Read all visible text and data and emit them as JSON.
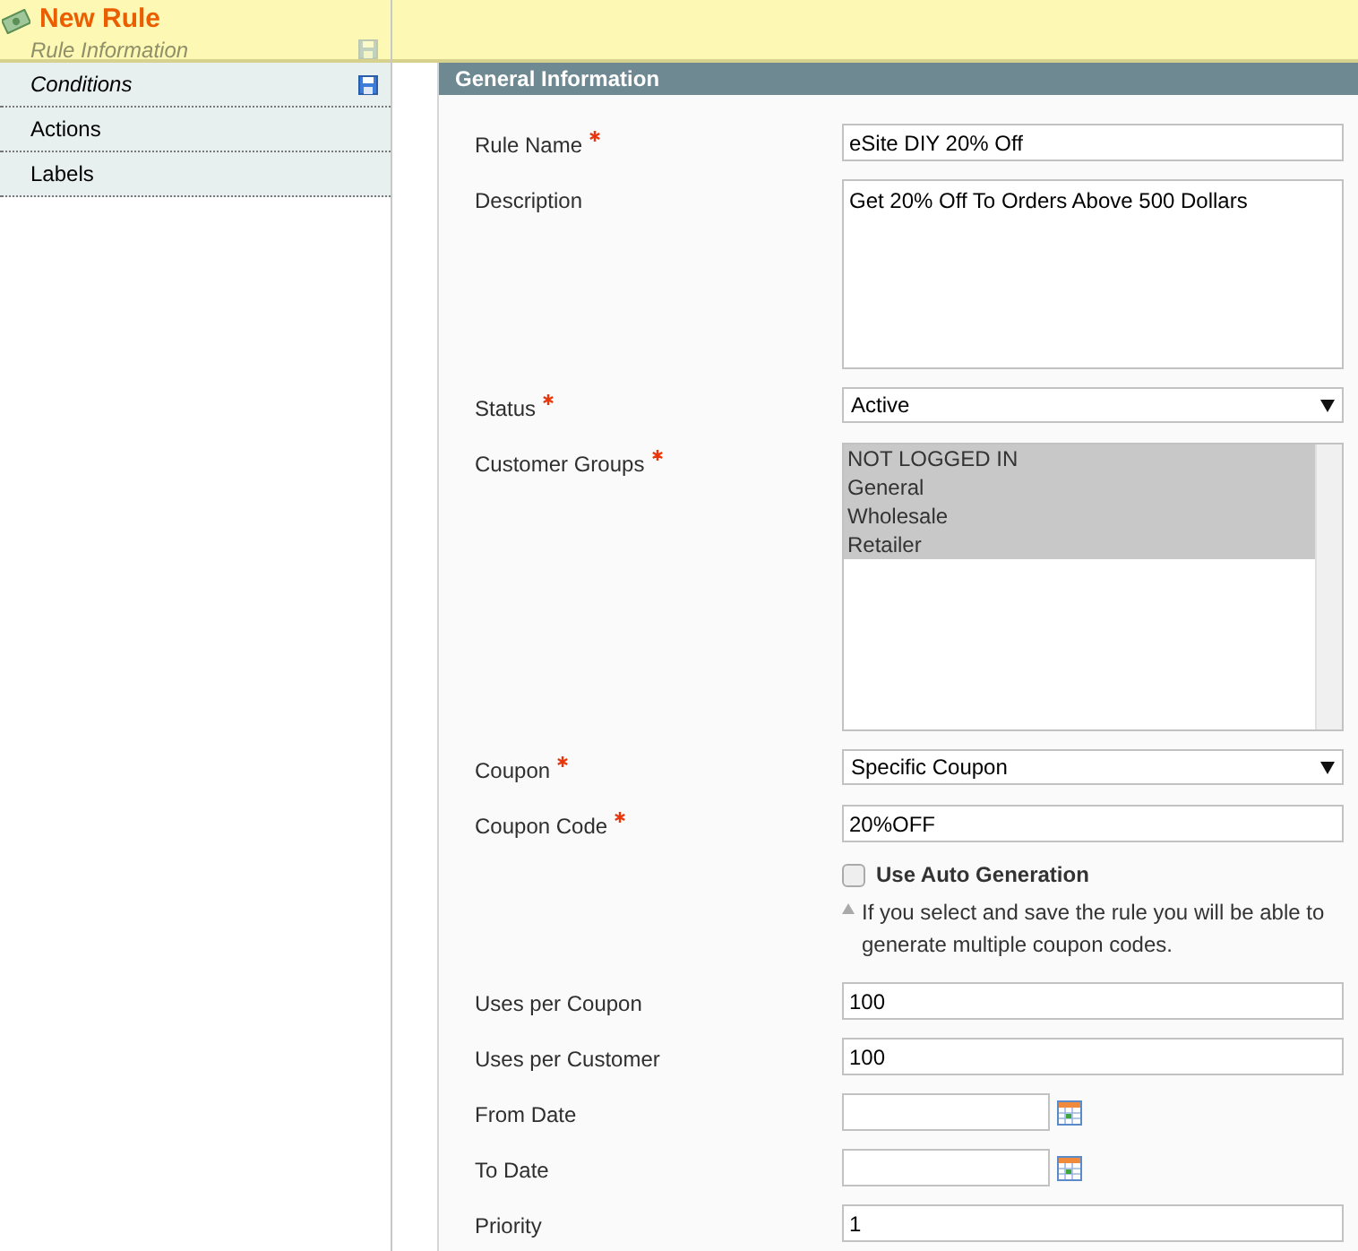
{
  "header": {
    "title": "New Rule"
  },
  "sidebar": {
    "items": [
      {
        "label": "Rule Information",
        "selected": true,
        "changed": true
      },
      {
        "label": "Conditions",
        "selected": false,
        "changed": true
      },
      {
        "label": "Actions",
        "selected": false,
        "changed": false
      },
      {
        "label": "Labels",
        "selected": false,
        "changed": false
      }
    ]
  },
  "section": {
    "title": "General Information"
  },
  "fields": [
    {
      "kind": "text",
      "label": "Rule Name",
      "required": true,
      "value": "eSite DIY 20% Off"
    },
    {
      "kind": "textarea",
      "label": "Description",
      "required": false,
      "value": "Get 20% Off To Orders Above 500 Dollars"
    },
    {
      "kind": "select",
      "label": "Status",
      "required": true,
      "value": "Active"
    },
    {
      "kind": "multiselect",
      "label": "Customer Groups",
      "required": true,
      "options": [
        {
          "label": "NOT LOGGED IN",
          "selected": true
        },
        {
          "label": "General",
          "selected": true
        },
        {
          "label": "Wholesale",
          "selected": true
        },
        {
          "label": "Retailer",
          "selected": true
        }
      ]
    },
    {
      "kind": "select",
      "label": "Coupon",
      "required": true,
      "value": "Specific Coupon"
    },
    {
      "kind": "text",
      "label": "Coupon Code",
      "required": true,
      "value": "20%OFF"
    },
    {
      "kind": "checkbox",
      "label": "Use Auto Generation",
      "checked": false,
      "note": "If you select and save the rule you will be able to generate multiple coupon codes."
    },
    {
      "kind": "text",
      "label": "Uses per Coupon",
      "required": false,
      "value": "100"
    },
    {
      "kind": "text",
      "label": "Uses per Customer",
      "required": false,
      "value": "100"
    },
    {
      "kind": "date",
      "label": "From Date",
      "required": false
    },
    {
      "kind": "date",
      "label": "To Date",
      "required": false
    },
    {
      "kind": "text",
      "label": "Priority",
      "required": false,
      "value": "1"
    }
  ]
}
